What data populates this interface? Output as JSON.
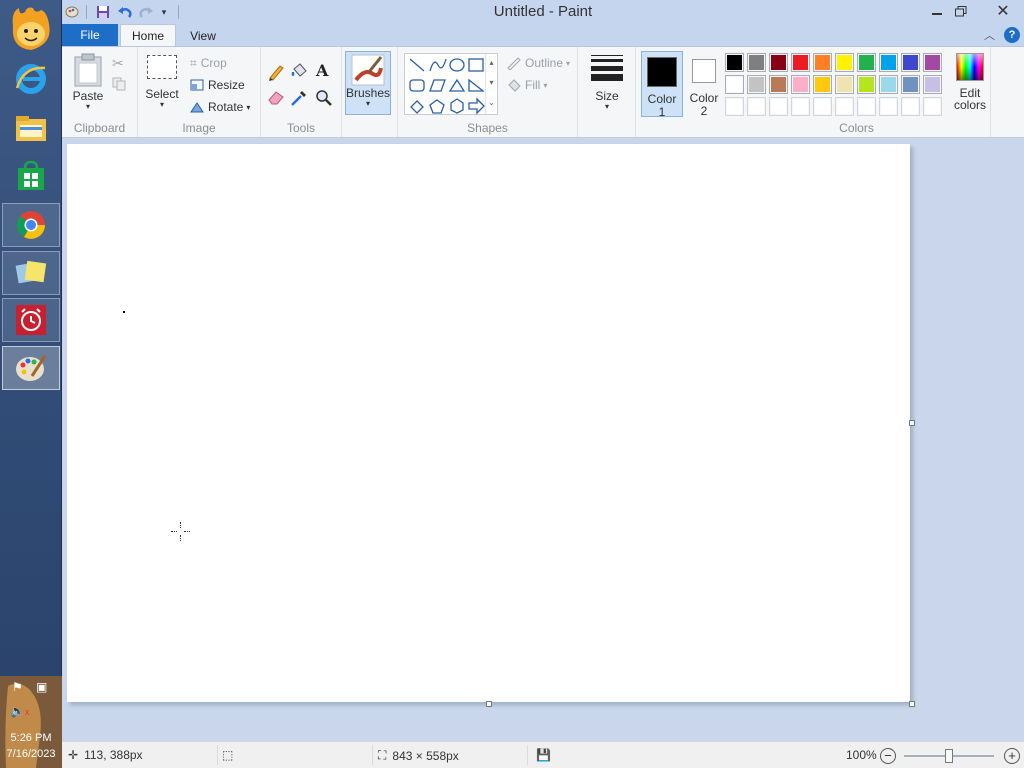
{
  "window": {
    "title": "Untitled - Paint"
  },
  "quick_access": {
    "save": "save-icon",
    "undo": "undo-icon",
    "redo": "redo-icon"
  },
  "tabs": {
    "file": "File",
    "home": "Home",
    "view": "View"
  },
  "clipboard": {
    "paste": "Paste",
    "group": "Clipboard"
  },
  "image": {
    "select": "Select",
    "crop": "Crop",
    "resize": "Resize",
    "rotate": "Rotate",
    "group": "Image"
  },
  "tools": {
    "group": "Tools"
  },
  "brushes": {
    "label": "Brushes"
  },
  "shapes": {
    "outline": "Outline",
    "fill": "Fill",
    "group": "Shapes"
  },
  "size": {
    "label": "Size"
  },
  "color1": {
    "label_a": "Color",
    "label_b": "1",
    "value": "#000000"
  },
  "color2": {
    "label_a": "Color",
    "label_b": "2",
    "value": "#ffffff"
  },
  "colors": {
    "group": "Colors",
    "edit_a": "Edit",
    "edit_b": "colors",
    "row1": [
      "#000000",
      "#7f7f7f",
      "#880015",
      "#ed1c24",
      "#ff7f27",
      "#fff200",
      "#22b14c",
      "#00a2e8",
      "#3f48cc",
      "#a349a4"
    ],
    "row2": [
      "#ffffff",
      "#c3c3c3",
      "#b97a57",
      "#ffaec9",
      "#ffc90e",
      "#efe4b0",
      "#b5e61d",
      "#99d9ea",
      "#7092be",
      "#c8bfe7"
    ],
    "row3": [
      "#ffffff",
      "#ffffff",
      "#ffffff",
      "#ffffff",
      "#ffffff",
      "#ffffff",
      "#ffffff",
      "#ffffff",
      "#ffffff",
      "#ffffff"
    ]
  },
  "status": {
    "cursor_pos": "113, 388px",
    "canvas_size": "843 × 558px",
    "zoom": "100%",
    "zoom_level": 1.0
  },
  "taskbar": {
    "time": "5:26 PM",
    "date": "7/16/2023"
  }
}
